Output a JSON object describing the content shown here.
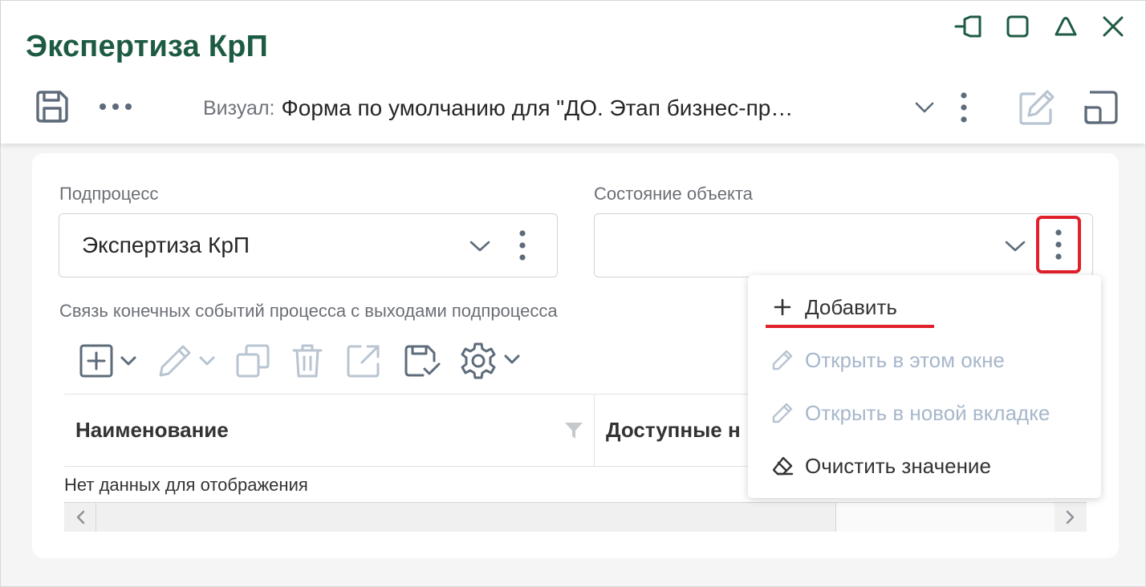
{
  "window": {
    "title": "Экспертиза КрП",
    "buttons": [
      "pin-icon",
      "maximize-icon",
      "collapse-icon",
      "close-icon"
    ]
  },
  "toolbar": {
    "visual_label": "Визуал:",
    "visual_value": "Форма по умолчанию для \"ДО. Этап бизнес-пр…"
  },
  "form": {
    "subprocess": {
      "label": "Подпроцесс",
      "value": "Экспертиза КрП"
    },
    "object_state": {
      "label": "Состояние объекта",
      "value": ""
    },
    "section_label": "Связь конечных событий процесса с выходами подпроцесса"
  },
  "table": {
    "columns": [
      "Наименование",
      "Доступные н"
    ],
    "empty_text": "Нет данных для отображения"
  },
  "context_menu": {
    "items": [
      {
        "label": "Добавить",
        "icon": "plus-icon",
        "enabled": true
      },
      {
        "label": "Открыть в этом окне",
        "icon": "pencil-icon",
        "enabled": false
      },
      {
        "label": "Открыть в новой вкладке",
        "icon": "pencil-icon",
        "enabled": false
      },
      {
        "label": "Очистить значение",
        "icon": "eraser-icon",
        "enabled": true
      }
    ]
  },
  "colors": {
    "title": "#1e5b43",
    "icon": "#5d6b7a",
    "icon_disabled": "#b8c4d2",
    "highlight": "#e0202a",
    "disabled_text": "#a7b7cb"
  }
}
